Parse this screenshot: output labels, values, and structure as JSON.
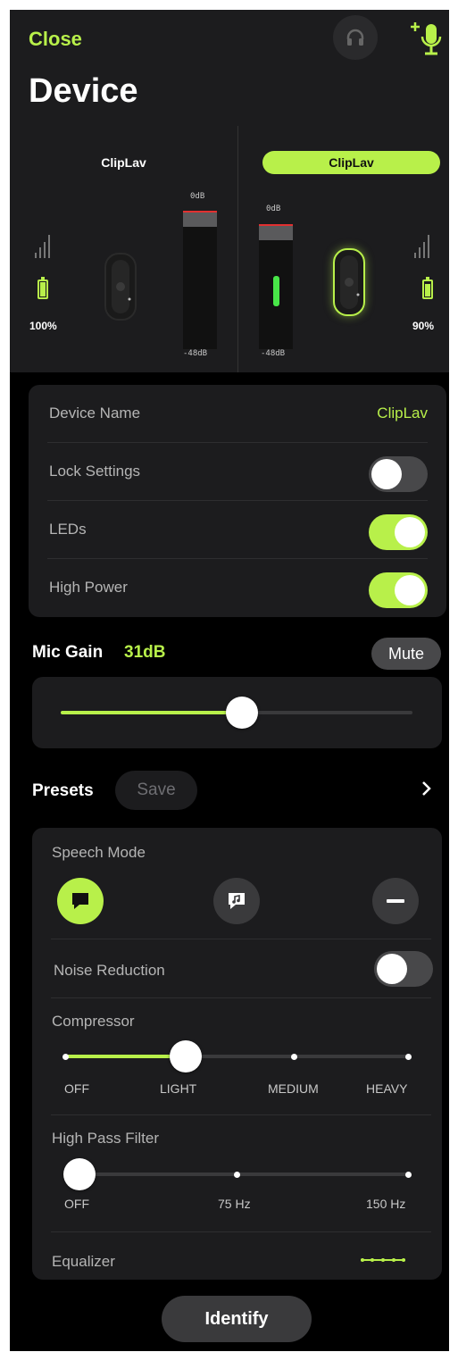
{
  "header": {
    "close_label": "Close",
    "title": "Device",
    "headphones_icon": "headphones-icon",
    "add_mic_icon": "add-microphone-icon"
  },
  "meters": {
    "left": {
      "name": "ClipLav",
      "db_top": "0dB",
      "db_bottom": "-48dB",
      "battery": "100%",
      "battery_level": 1.0,
      "selected": false
    },
    "right": {
      "name": "ClipLav",
      "db_top": "0dB",
      "db_bottom": "-48dB",
      "battery": "90%",
      "battery_level": 0.9,
      "selected": true
    }
  },
  "settings": {
    "device_name_label": "Device Name",
    "device_name_value": "ClipLav",
    "lock_label": "Lock Settings",
    "lock_on": false,
    "leds_label": "LEDs",
    "leds_on": true,
    "high_power_label": "High Power",
    "high_power_on": true
  },
  "gain": {
    "label": "Mic Gain",
    "value": "31dB",
    "mute_label": "Mute",
    "level": 0.51
  },
  "presets": {
    "label": "Presets",
    "save_label": "Save"
  },
  "speech": {
    "label": "Speech Mode",
    "modes": [
      "speech-bubble-icon",
      "music-bubble-icon",
      "minus-icon"
    ],
    "selected": 0,
    "noise_label": "Noise Reduction",
    "noise_on": false,
    "compressor_label": "Compressor",
    "compressor_stops": [
      "OFF",
      "LIGHT",
      "MEDIUM",
      "HEAVY"
    ],
    "compressor_selected": 1,
    "hpf_label": "High Pass Filter",
    "hpf_stops": [
      "OFF",
      "75 Hz",
      "150 Hz"
    ],
    "hpf_selected": 0,
    "eq_label": "Equalizer"
  },
  "footer": {
    "identify_label": "Identify"
  },
  "colors": {
    "accent": "#b8f04a",
    "background": "#000000",
    "card": "#1c1c1e",
    "meter_green": "#48e648",
    "peak_red": "#e23030"
  }
}
